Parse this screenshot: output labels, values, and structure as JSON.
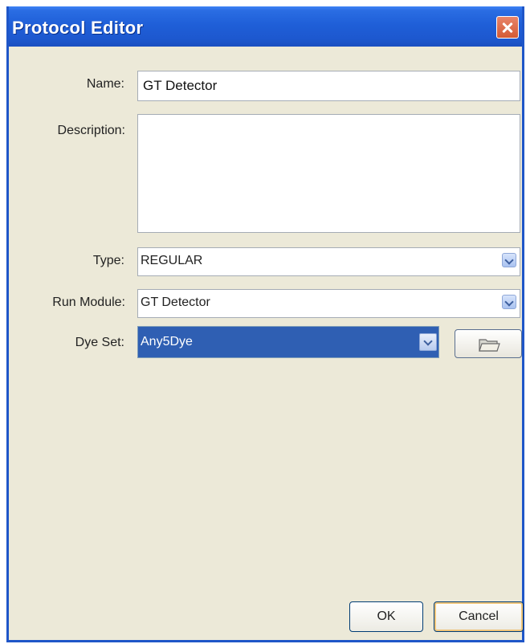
{
  "window": {
    "title": "Protocol Editor"
  },
  "form": {
    "name_label": "Name:",
    "name_value": "GT Detector",
    "description_label": "Description:",
    "description_value": "",
    "type_label": "Type:",
    "type_value": "REGULAR",
    "run_module_label": "Run Module:",
    "run_module_value": "GT Detector",
    "dye_set_label": "Dye Set:",
    "dye_set_value": "Any5Dye"
  },
  "buttons": {
    "ok_label": "OK",
    "cancel_label": "Cancel"
  },
  "icons": {
    "close": "close-icon",
    "dropdown": "chevron-down-icon",
    "browse": "folder-icon"
  },
  "colors": {
    "titlebar": "#1f5fd8",
    "dialog_bg": "#ece9d8",
    "selection": "#2f5fb3"
  }
}
